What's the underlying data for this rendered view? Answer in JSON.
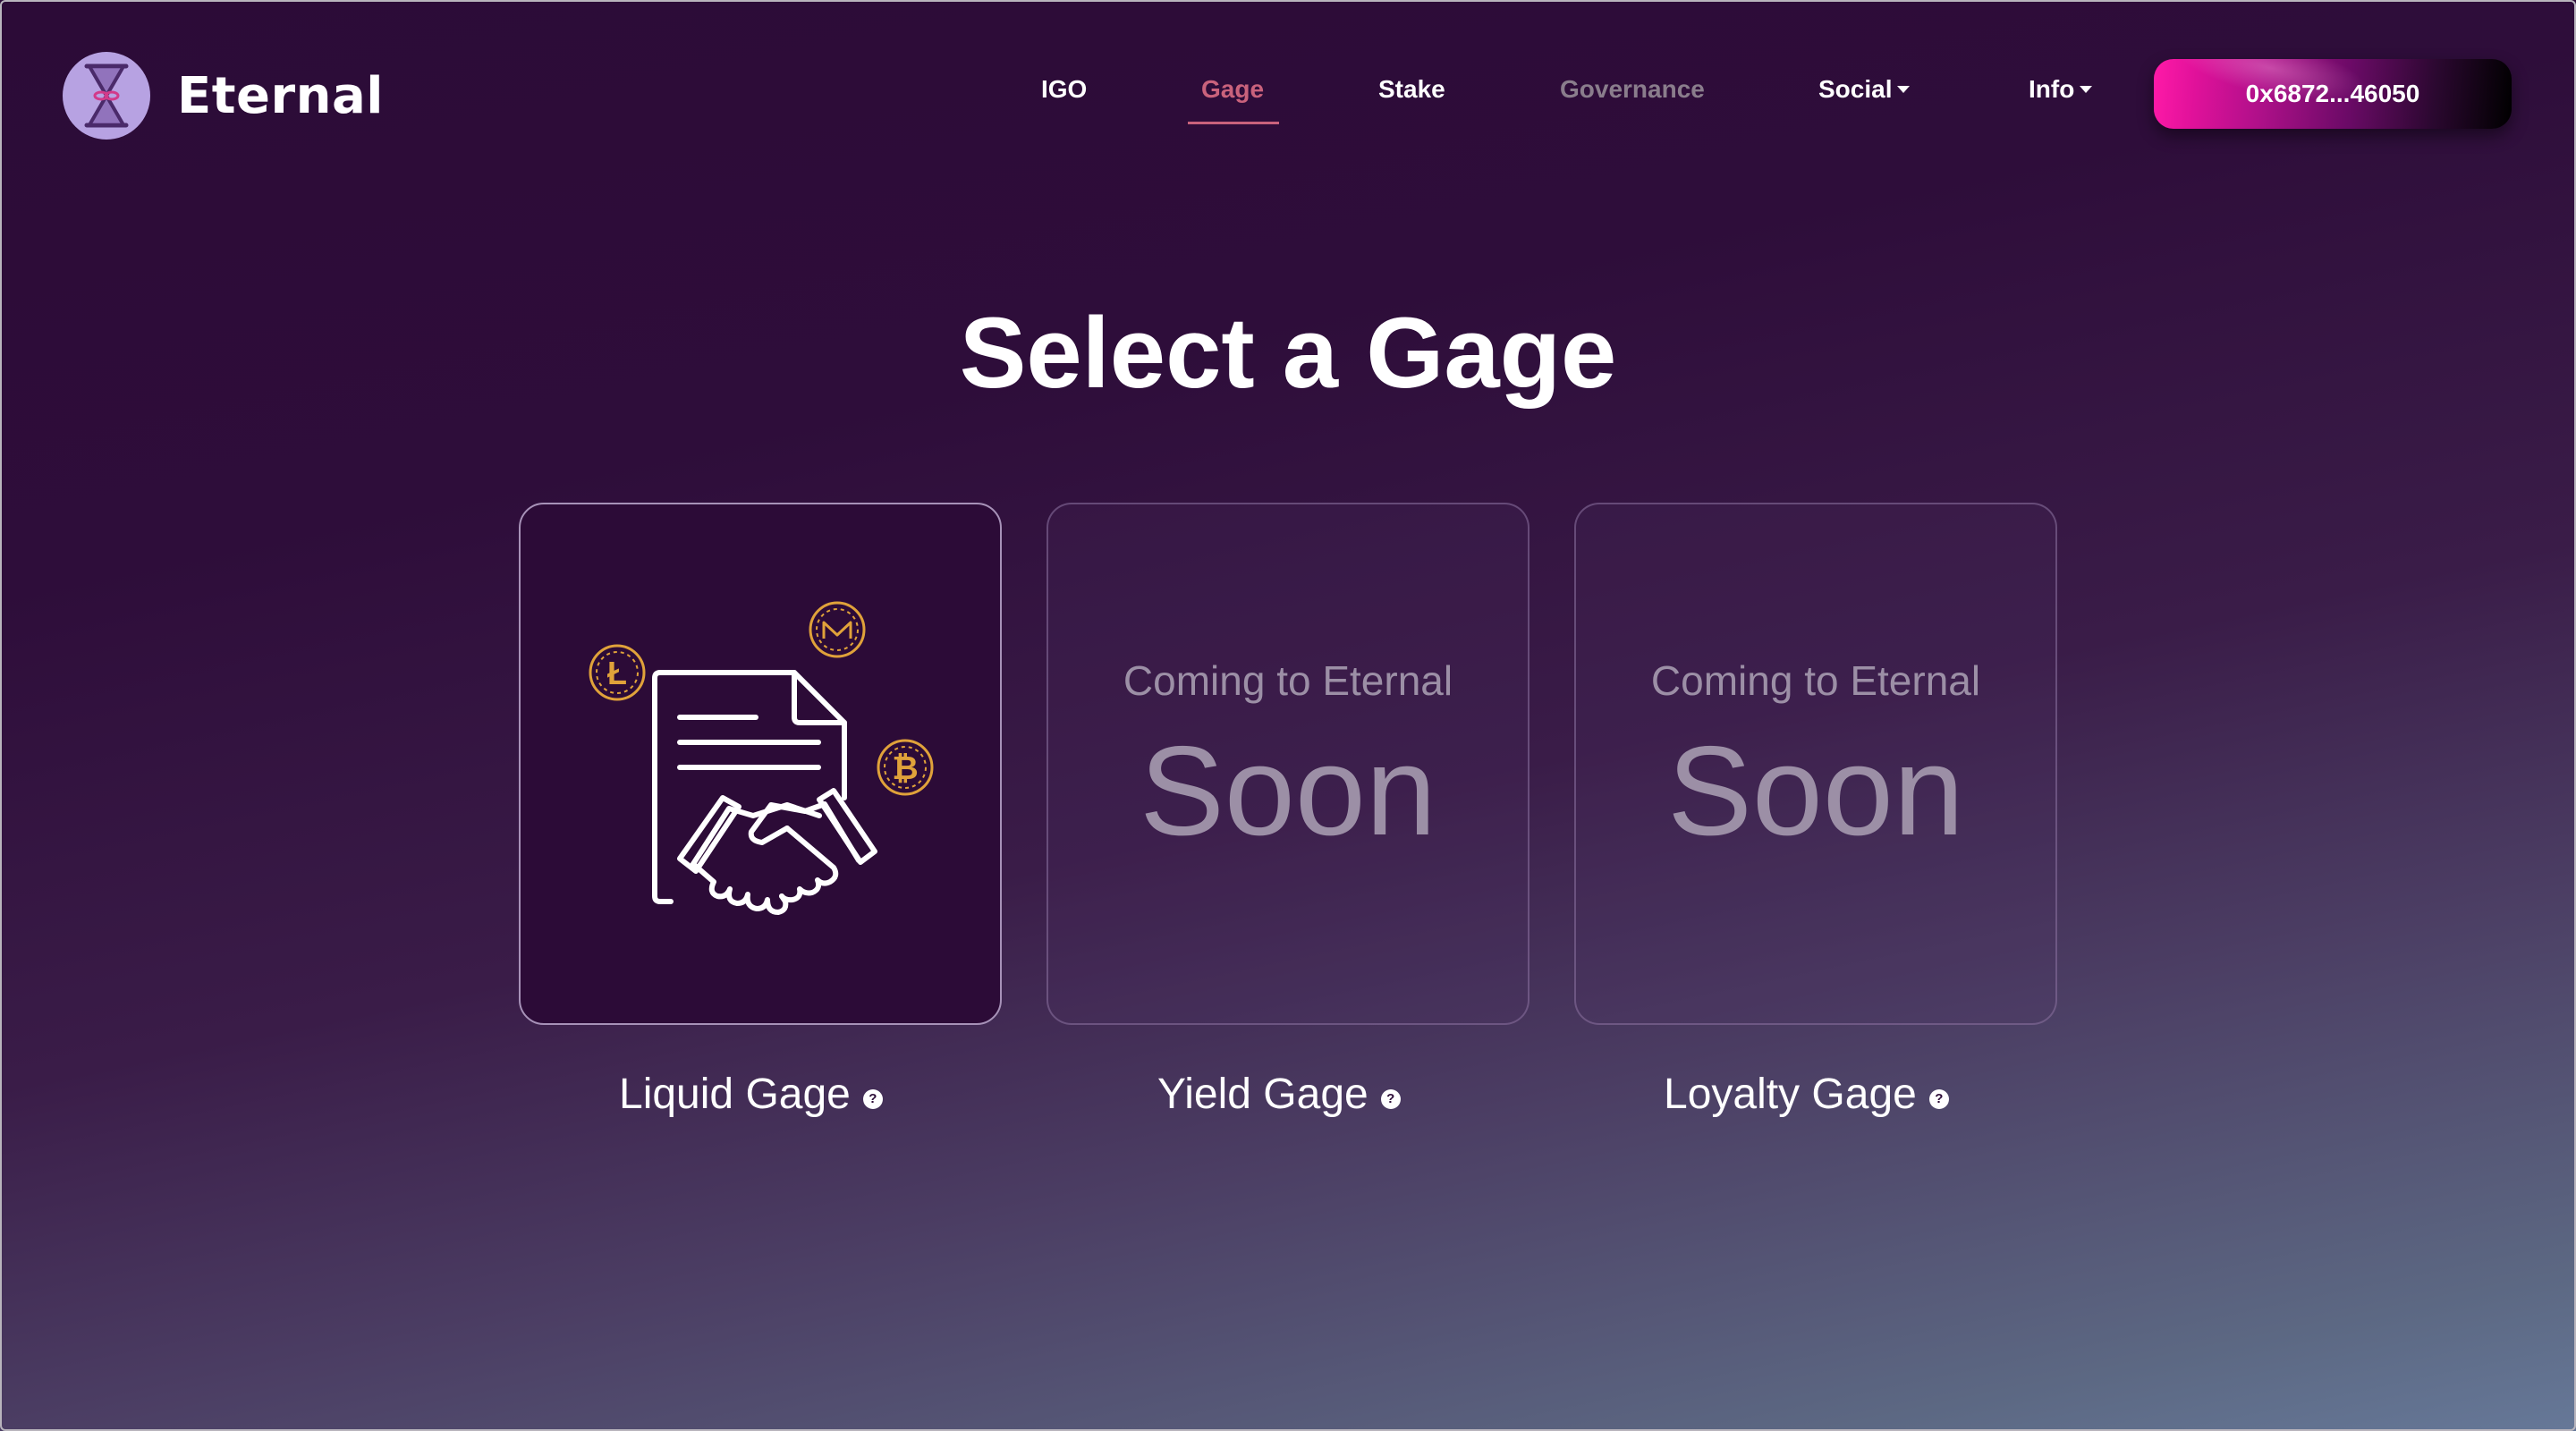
{
  "brand": {
    "name": "Eternal",
    "logo_icon": "hourglass-icon"
  },
  "nav": {
    "items": [
      {
        "label": "IGO",
        "state": "default"
      },
      {
        "label": "Gage",
        "state": "active"
      },
      {
        "label": "Stake",
        "state": "default"
      },
      {
        "label": "Governance",
        "state": "disabled"
      },
      {
        "label": "Social",
        "state": "dropdown"
      },
      {
        "label": "Info",
        "state": "dropdown"
      }
    ],
    "wallet_label": "0x6872...46050"
  },
  "main": {
    "title": "Select a Gage",
    "cards": [
      {
        "label": "Liquid Gage",
        "status": "available",
        "icon": "contract-handshake-icon",
        "coin_icons": [
          "litecoin-icon",
          "monero-icon",
          "bitcoin-icon"
        ]
      },
      {
        "label": "Yield Gage",
        "status": "coming-soon",
        "subtitle": "Coming to Eternal",
        "headline": "Soon"
      },
      {
        "label": "Loyalty Gage",
        "status": "coming-soon",
        "subtitle": "Coming to Eternal",
        "headline": "Soon"
      }
    ],
    "help_glyph": "?"
  },
  "colors": {
    "background_top": "#2c0b37",
    "background_bottom": "#667898",
    "active_nav": "#c9627c",
    "muted_nav": "#8a7d8c",
    "coin_gold": "#e0a23a",
    "soon_text": "#9c8fa6",
    "logo_bg": "#b7a2e2"
  }
}
